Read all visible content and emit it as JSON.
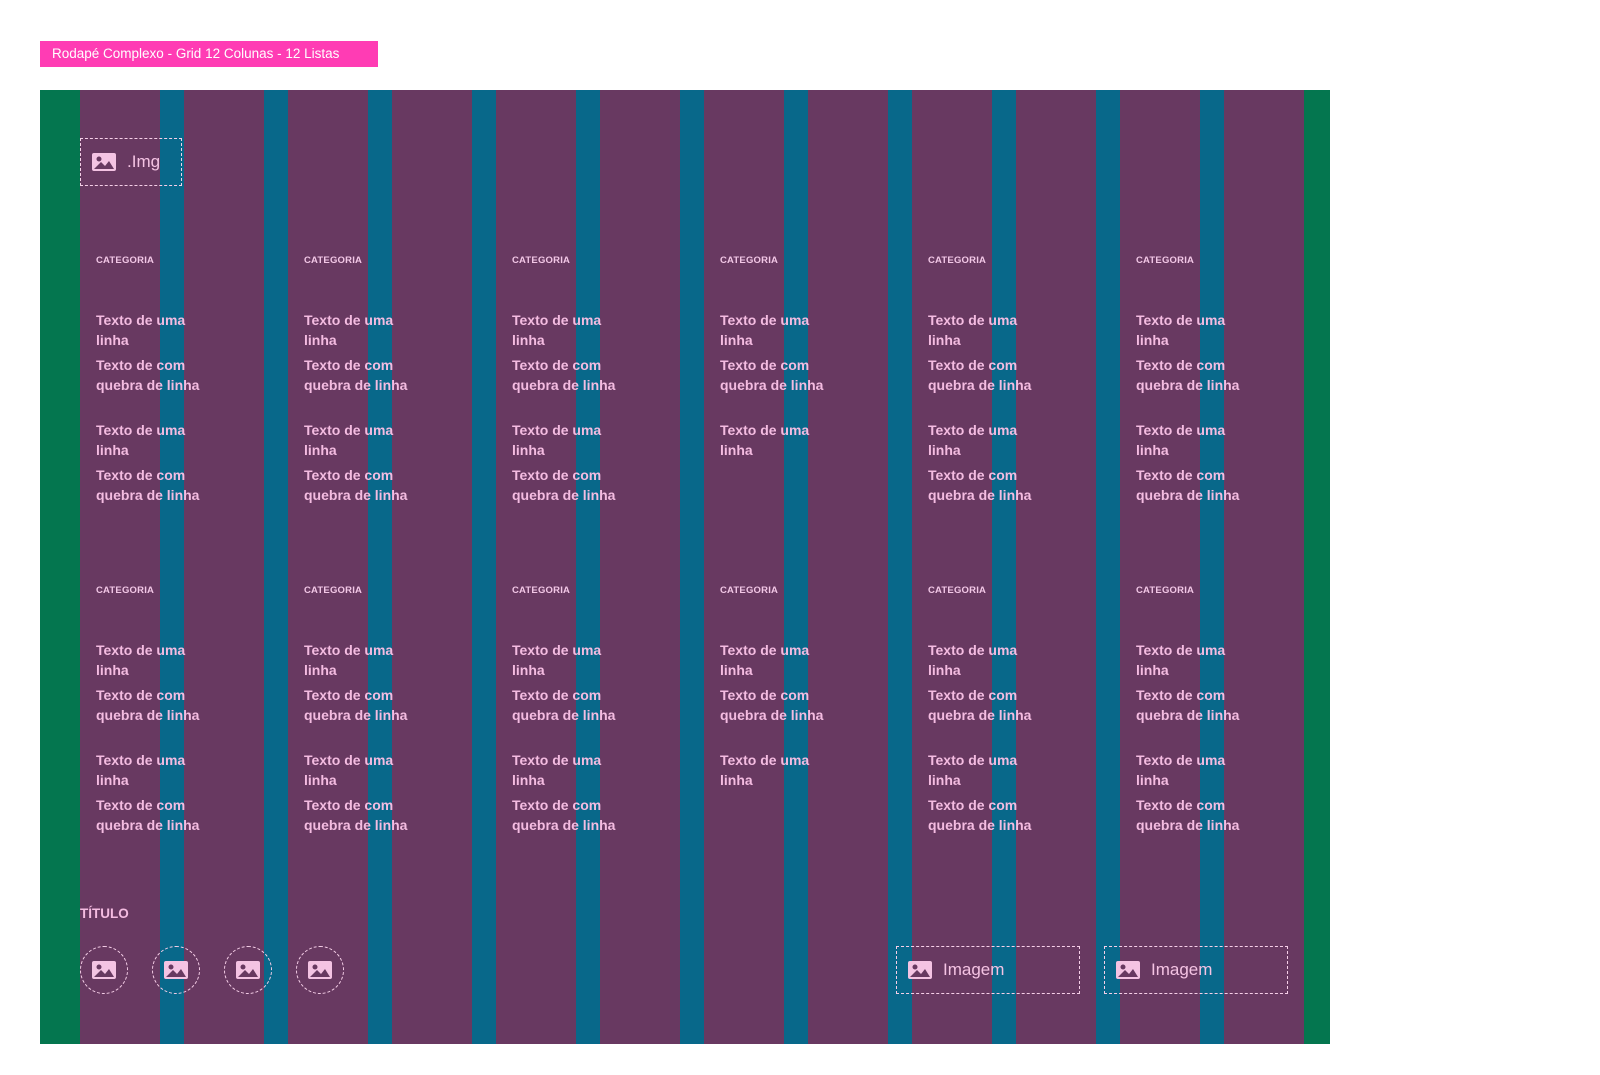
{
  "header": {
    "tag": "Rodapé Complexo - Grid 12 Colunas - 12 Listas"
  },
  "colors": {
    "tag": "#ff3cb4",
    "margin": "#04764f",
    "gutter": "#08688a",
    "column": "#683961",
    "text": "#f4bce1"
  },
  "logo": {
    "label": ".Img",
    "icon": "image-icon"
  },
  "lists": [
    {
      "category": "CATEGORIA",
      "items": [
        "Texto de uma linha",
        "Texto de com quebra de linha",
        "Texto de uma linha",
        "Texto de com quebra de linha"
      ]
    },
    {
      "category": "CATEGORIA",
      "items": [
        "Texto de uma linha",
        "Texto de com quebra de linha",
        "Texto de uma linha",
        "Texto de com quebra de linha"
      ]
    },
    {
      "category": "CATEGORIA",
      "items": [
        "Texto de uma linha",
        "Texto de com quebra de linha",
        "Texto de uma linha",
        "Texto de com quebra de linha"
      ]
    },
    {
      "category": "CATEGORIA",
      "items": [
        "Texto de uma linha",
        "Texto de com quebra de linha",
        "Texto de uma linha"
      ]
    },
    {
      "category": "CATEGORIA",
      "items": [
        "Texto de uma linha",
        "Texto de com quebra de linha",
        "Texto de uma linha",
        "Texto de com quebra de linha"
      ]
    },
    {
      "category": "CATEGORIA",
      "items": [
        "Texto de uma linha",
        "Texto de com quebra de linha",
        "Texto de uma linha",
        "Texto de com quebra de linha"
      ]
    },
    {
      "category": "CATEGORIA",
      "items": [
        "Texto de uma linha",
        "Texto de com quebra de linha",
        "Texto de uma linha",
        "Texto de com quebra de linha"
      ]
    },
    {
      "category": "CATEGORIA",
      "items": [
        "Texto de uma linha",
        "Texto de com quebra de linha",
        "Texto de uma linha",
        "Texto de com quebra de linha"
      ]
    },
    {
      "category": "CATEGORIA",
      "items": [
        "Texto de uma linha",
        "Texto de com quebra de linha",
        "Texto de uma linha",
        "Texto de com quebra de linha"
      ]
    },
    {
      "category": "CATEGORIA",
      "items": [
        "Texto de uma linha",
        "Texto de com quebra de linha",
        "Texto de uma linha"
      ]
    },
    {
      "category": "CATEGORIA",
      "items": [
        "Texto de uma linha",
        "Texto de com quebra de linha",
        "Texto de uma linha",
        "Texto de com quebra de linha"
      ]
    },
    {
      "category": "CATEGORIA",
      "items": [
        "Texto de uma linha",
        "Texto de com quebra de linha",
        "Texto de uma linha",
        "Texto de com quebra de linha"
      ]
    }
  ],
  "social": {
    "title": "TÍTULO",
    "icons": [
      "image-icon",
      "image-icon",
      "image-icon",
      "image-icon"
    ]
  },
  "badges": [
    {
      "label": "Imagem",
      "icon": "image-icon"
    },
    {
      "label": "Imagem",
      "icon": "image-icon"
    }
  ]
}
